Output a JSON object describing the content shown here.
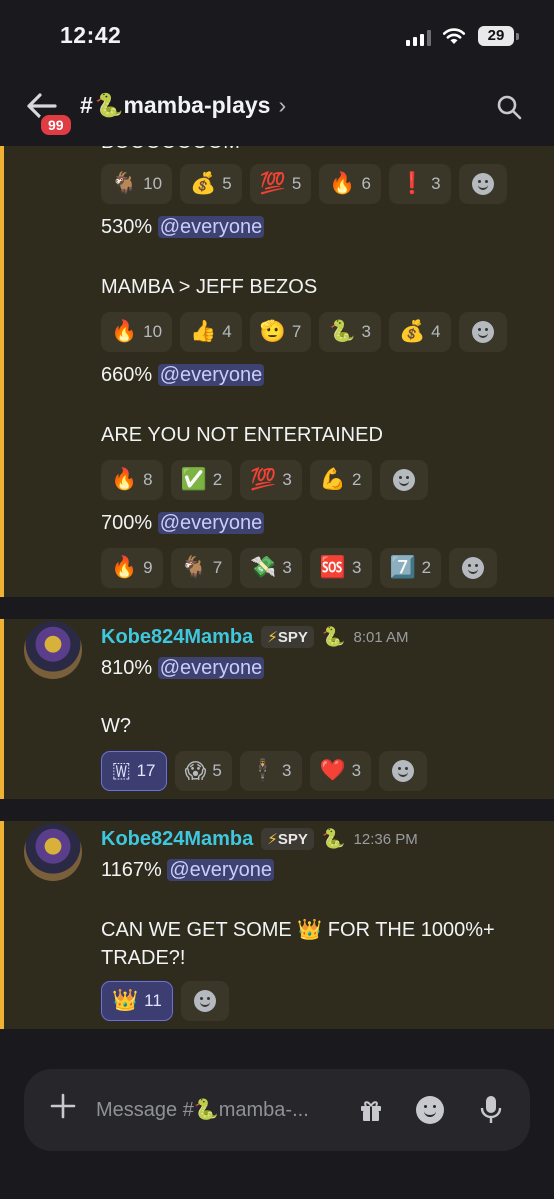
{
  "status": {
    "time": "12:42",
    "battery": "29"
  },
  "header": {
    "unread_count": "99",
    "channel_hash": "#",
    "channel_emoji": "🐍",
    "channel_name": "mamba-plays",
    "chevron": "›"
  },
  "top_cropped_text": "BOOOOOOOM",
  "block1": {
    "reactions_a": [
      {
        "emoji": "🐐",
        "count": "10"
      },
      {
        "emoji": "💰",
        "count": "5"
      },
      {
        "emoji": "💯",
        "count": "5"
      },
      {
        "emoji": "🔥",
        "count": "6"
      },
      {
        "emoji": "❗",
        "count": "3"
      }
    ],
    "msg_530_pct": "530%",
    "mention": "@everyone",
    "msg_bezos": "MAMBA > JEFF BEZOS",
    "reactions_b": [
      {
        "emoji": "🔥",
        "count": "10"
      },
      {
        "emoji": "👍",
        "count": "4"
      },
      {
        "emoji": "🫡",
        "count": "7"
      },
      {
        "emoji": "🐍",
        "count": "3"
      },
      {
        "emoji": "💰",
        "count": "4"
      }
    ],
    "msg_660_pct": "660%",
    "msg_entertained": "ARE YOU NOT ENTERTAINED",
    "reactions_c": [
      {
        "emoji": "🔥",
        "count": "8"
      },
      {
        "emoji": "✅",
        "count": "2"
      },
      {
        "emoji": "💯",
        "count": "3"
      },
      {
        "emoji": "💪",
        "count": "2"
      }
    ],
    "msg_700_pct": "700%",
    "reactions_d": [
      {
        "emoji": "🔥",
        "count": "9"
      },
      {
        "emoji": "🐐",
        "count": "7"
      },
      {
        "emoji": "💸",
        "count": "3"
      },
      {
        "emoji": "🆘",
        "count": "3"
      },
      {
        "emoji": "7️⃣",
        "count": "2"
      }
    ]
  },
  "block2": {
    "author": "Kobe824Mamba",
    "tag": "SPY",
    "tag_bolt": "⚡",
    "author_emoji": "🐍",
    "time": "8:01 AM",
    "pct": "810%",
    "mention": "@everyone",
    "line2": "W?",
    "reactions": [
      {
        "emoji": "🇼",
        "count": "17",
        "active": true
      },
      {
        "emoji": "😱",
        "count": "5"
      },
      {
        "emoji": "🕴️",
        "count": "3"
      },
      {
        "emoji": "❤️",
        "count": "3"
      }
    ]
  },
  "block3": {
    "author": "Kobe824Mamba",
    "tag": "SPY",
    "tag_bolt": "⚡",
    "author_emoji": "🐍",
    "time": "12:36 PM",
    "pct": "1167%",
    "mention": "@everyone",
    "line2a_pre": "CAN WE GET SOME ",
    "line2a_emoji": "👑",
    "line2a_post": " FOR THE 1000%+",
    "line2b": "TRADE?!",
    "reactions": [
      {
        "emoji": "👑",
        "count": "11",
        "active": true
      }
    ]
  },
  "composer": {
    "placeholder": "Message #🐍mamba-..."
  }
}
